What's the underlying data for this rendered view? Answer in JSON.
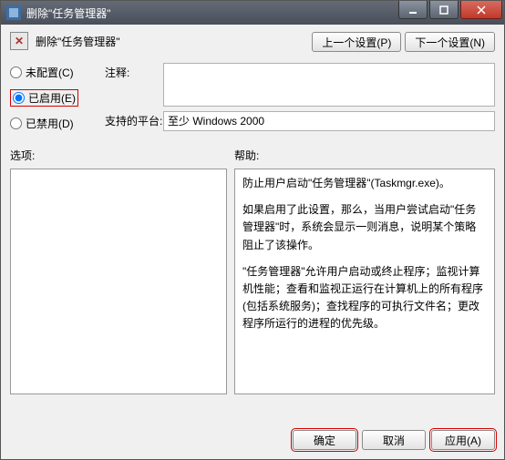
{
  "titlebar": {
    "title": "删除\"任务管理器\""
  },
  "header": {
    "label": "删除\"任务管理器\"",
    "prev_btn": "上一个设置(P)",
    "next_btn": "下一个设置(N)"
  },
  "radios": {
    "not_configured": "未配置(C)",
    "enabled": "已启用(E)",
    "disabled": "已禁用(D)",
    "selected": "enabled"
  },
  "fields": {
    "comment_label": "注释:",
    "comment_value": "",
    "platform_label": "支持的平台:",
    "platform_value": "至少 Windows 2000"
  },
  "lower": {
    "options_label": "选项:",
    "help_label": "帮助:"
  },
  "help_text": {
    "p1": "防止用户启动\"任务管理器\"(Taskmgr.exe)。",
    "p2": "如果启用了此设置，那么，当用户尝试启动\"任务管理器\"时，系统会显示一则消息，说明某个策略阻止了该操作。",
    "p3": "\"任务管理器\"允许用户启动或终止程序；监视计算机性能；查看和监视正运行在计算机上的所有程序(包括系统服务)；查找程序的可执行文件名；更改程序所运行的进程的优先级。"
  },
  "buttons": {
    "ok": "确定",
    "cancel": "取消",
    "apply": "应用(A)"
  }
}
